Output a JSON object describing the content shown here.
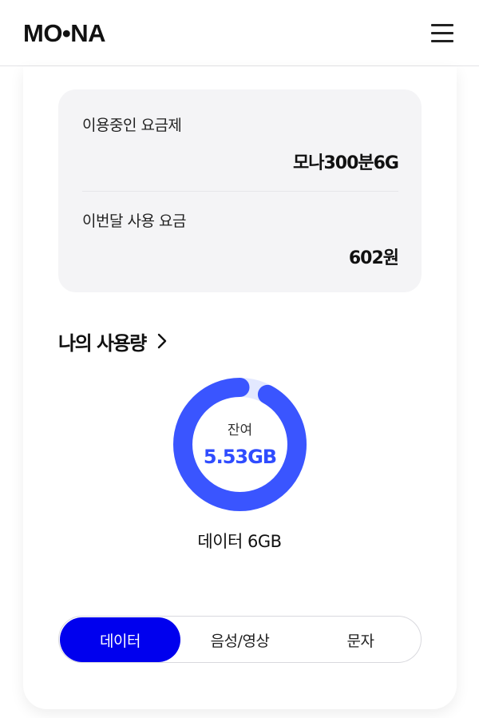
{
  "header": {
    "logo": "MO•NA",
    "menu_icon": "hamburger-menu-icon"
  },
  "plan": {
    "current_plan_label": "이용중인 요금제",
    "current_plan_value": "모나300분6G",
    "monthly_fee_label": "이번달 사용 요금",
    "monthly_fee_value": "602원"
  },
  "usage": {
    "title": "나의 사용량",
    "chevron_icon": "chevron-right-icon",
    "remaining_label": "잔여",
    "remaining_value": "5.53GB",
    "remaining_fraction": 0.92,
    "data_caption": "데이터 6GB"
  },
  "tabs": [
    {
      "label": "데이터",
      "active": true
    },
    {
      "label": "음성/영상",
      "active": false
    },
    {
      "label": "문자",
      "active": false
    }
  ],
  "colors": {
    "accent_blue": "#3a55ff",
    "donut_track": "#e3e8ff",
    "active_tab": "#0000ee"
  }
}
